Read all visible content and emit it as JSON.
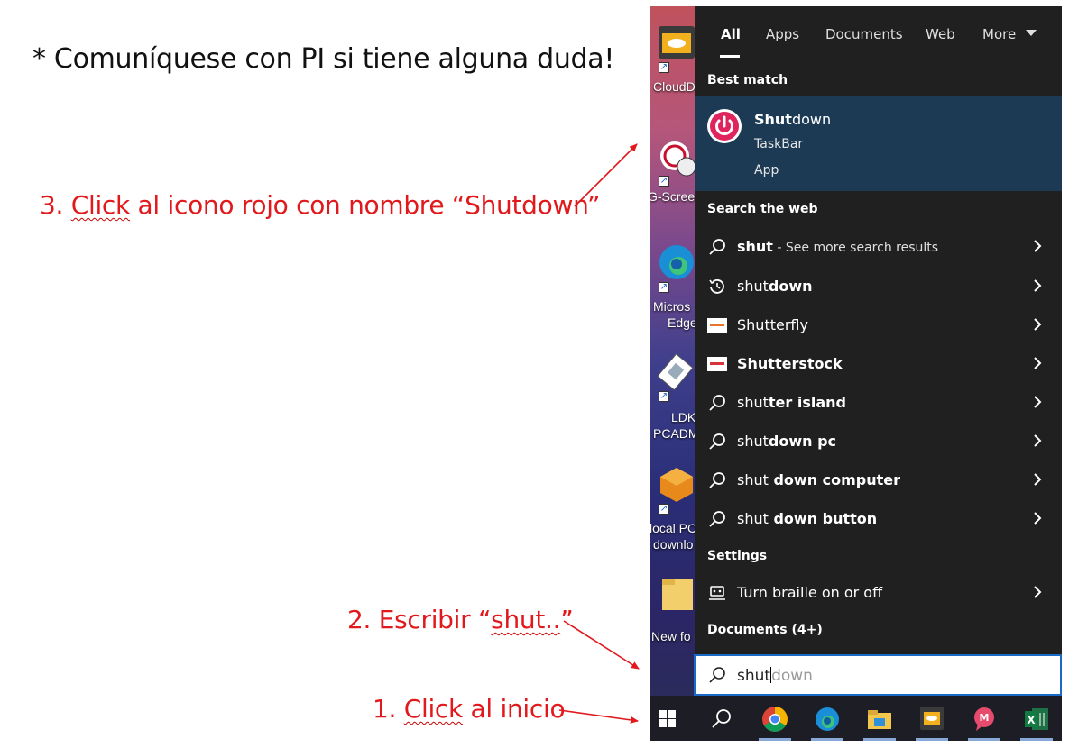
{
  "instructions": {
    "note": "* Comuníquese con PI si tiene alguna duda!",
    "step3_prefix": "3. ",
    "step3_link": "Click",
    "step3_rest": " al icono rojo con nombre “Shutdown”",
    "step2_prefix": "2. Escribir “",
    "step2_link": "shut..",
    "step2_suffix": "”",
    "step1_prefix": "1. ",
    "step1_link": "Click",
    "step1_rest": " al inicio",
    "color": "#e2191c"
  },
  "desktop": {
    "icons": [
      {
        "label": "CloudD",
        "icon": "cloud-drive-icon"
      },
      {
        "label": "G-Screen",
        "icon": "g-screen-icon"
      },
      {
        "label": "Micros",
        "label2": "Edge",
        "icon": "edge-icon"
      },
      {
        "label": "LDK",
        "label2": "PCADM",
        "icon": "ldk-icon"
      },
      {
        "label": "local PC",
        "label2": "downlo",
        "icon": "package-icon"
      },
      {
        "label": "New fo",
        "icon": "folder-icon"
      }
    ]
  },
  "search_panel": {
    "tabs": [
      {
        "label": "All",
        "active": true
      },
      {
        "label": "Apps"
      },
      {
        "label": "Documents"
      },
      {
        "label": "Web"
      },
      {
        "label": "More"
      }
    ],
    "best_match_heading": "Best match",
    "best_match": {
      "name_bold": "Shut",
      "name_rest": "down",
      "sub1": "TaskBar",
      "sub2": "App",
      "icon": "power-icon",
      "icon_color": "#e0245e"
    },
    "search_web_heading": "Search the web",
    "web_results": [
      {
        "icon": "search-icon",
        "bold": "shut",
        "rest": "",
        "extra": " - See more search results"
      },
      {
        "icon": "history-icon",
        "bold": "shut",
        "rest": "down",
        "extra": ""
      },
      {
        "icon": "shutterfly-logo-icon",
        "bold": "",
        "rest": "Shutterfly",
        "extra": ""
      },
      {
        "icon": "shutterstock-logo-icon",
        "bold": "",
        "rest": "Shutterstock",
        "extra": ""
      },
      {
        "icon": "search-icon",
        "bold": "shut",
        "rest": "ter island",
        "extra": ""
      },
      {
        "icon": "search-icon",
        "bold": "shut",
        "rest": "down pc",
        "extra": ""
      },
      {
        "icon": "search-icon",
        "bold": "shut",
        "rest": " down computer",
        "extra": ""
      },
      {
        "icon": "search-icon",
        "bold": "shut",
        "rest": " down button",
        "extra": ""
      }
    ],
    "settings_heading": "Settings",
    "settings_result": {
      "icon": "braille-icon",
      "label": "Turn braille on or off"
    },
    "documents_heading": "Documents (4+)"
  },
  "search_box": {
    "typed": "shut",
    "suggestion": "down"
  },
  "taskbar": {
    "items": [
      "start-icon",
      "search-icon",
      "chrome-icon",
      "edge-icon",
      "file-explorer-icon",
      "app-icon",
      "chat-icon",
      "excel-icon"
    ],
    "excel_letter": "X"
  }
}
